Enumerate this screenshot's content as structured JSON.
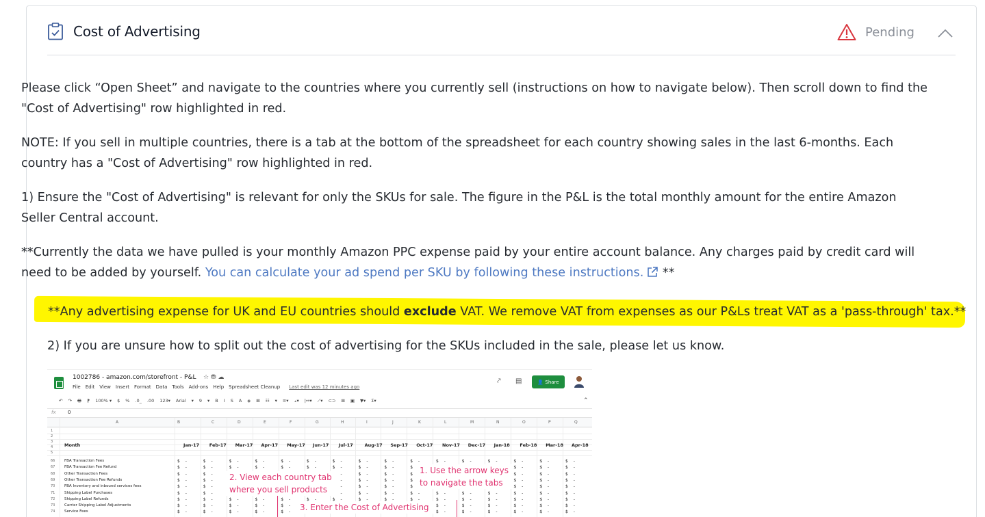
{
  "card": {
    "title": "Cost of Advertising",
    "status": "Pending",
    "icons": {
      "title": "clipboard-check-icon",
      "status": "warning-triangle-icon",
      "collapse": "chevron-up-icon",
      "external": "external-link-icon"
    },
    "colors": {
      "warning": "#d9363e",
      "link": "#4e79c2",
      "highlight": "#fff600"
    }
  },
  "content": {
    "p1": "Please click “Open Sheet” and navigate to the countries where you currently sell (instructions on how to navigate below). Then scroll down to find the \"Cost of Advertising\" row highlighted in red.",
    "p2": "NOTE: If you sell in multiple countries, there is a tab at the bottom of the spreadsheet for each country showing sales in the last 6-months. Each country has a \"Cost of Advertising\" row highlighted in red.",
    "p3": "1) Ensure the \"Cost of Advertising\" is relevant for only the SKUs for sale. The figure in the P&L is the total monthly amount for the entire Amazon Seller Central account.",
    "p4_before": "**Currently the data we have pulled is your monthly Amazon PPC expense paid by your entire account balance. Any charges paid by credit card will need to be added by yourself. ",
    "p4_link": "You can calculate your ad spend per SKU by following these instructions.",
    "p4_after": " **",
    "hl_before": "**Any advertising expense for UK and EU countries should ",
    "hl_bold": "exclude",
    "hl_after": " VAT. We remove VAT from expenses as our P&Ls treat VAT as a 'pass-through' tax.**",
    "p5": "2) If you are unsure how to split out the cost of advertising for the SKUs included in the sale, please let us know."
  },
  "screenshot": {
    "doc_title": "1002786 - amazon.com/storefront - P&L",
    "menu": [
      "File",
      "Edit",
      "View",
      "Insert",
      "Format",
      "Data",
      "Tools",
      "Add-ons",
      "Help",
      "Spreadsheet Cleanup"
    ],
    "last_edit": "Last edit was 12 minutes ago",
    "share": "Share",
    "toolbar": [
      "↶",
      "↷",
      "🖶",
      "⁋",
      "100% ▾",
      "$",
      "%",
      ".0_",
      ".00",
      "123▾",
      "Arial",
      "▾",
      "9",
      "▾",
      "B",
      "I",
      "S",
      "A",
      "◈",
      "⊞",
      "☷",
      "▾",
      "≡▾",
      "⫠▾",
      "|↔▾",
      "⟋▾",
      "⊂⊃",
      "⊞",
      "▣",
      "▼▾",
      "Σ▾"
    ],
    "formula_value": "0",
    "columns": [
      "A",
      "B",
      "C",
      "D",
      "E",
      "F",
      "G",
      "H",
      "I",
      "J",
      "K",
      "L",
      "M",
      "N",
      "O",
      "P",
      "Q"
    ],
    "month_label": "Month",
    "months": [
      "Jan-17",
      "Feb-17",
      "Mar-17",
      "Apr-17",
      "May-17",
      "Jun-17",
      "Jul-17",
      "Aug-17",
      "Sep-17",
      "Oct-17",
      "Nov-17",
      "Dec-17",
      "Jan-18",
      "Feb-18",
      "Mar-18",
      "Apr-18"
    ],
    "row_numbers_top": [
      "1",
      "2",
      "3",
      "4",
      "5"
    ],
    "rows": [
      {
        "n": "66",
        "label": "FBA Transaction Fees"
      },
      {
        "n": "67",
        "label": "FBA Transaction Fee Refund"
      },
      {
        "n": "68",
        "label": "Other Transaction Fees"
      },
      {
        "n": "69",
        "label": "Other Transaction Fee Refunds"
      },
      {
        "n": "70",
        "label": "FBA Inventory and inbound services fees"
      },
      {
        "n": "71",
        "label": "Shipping Label Purchases"
      },
      {
        "n": "72",
        "label": "Shipping Label Refunds"
      },
      {
        "n": "73",
        "label": "Carrier Shipping Label Adjustments"
      },
      {
        "n": "74",
        "label": "Service Fees"
      }
    ],
    "annotations": {
      "a1": "1. Use the arrow keys to navigate the tabs",
      "a1_l1": "1. Use the arrow keys",
      "a1_l2": "to navigate the tabs",
      "a2_l1": "2. View each country tab",
      "a2_l2": "where you sell products",
      "a3": "3. Enter the Cost of Advertising"
    }
  }
}
